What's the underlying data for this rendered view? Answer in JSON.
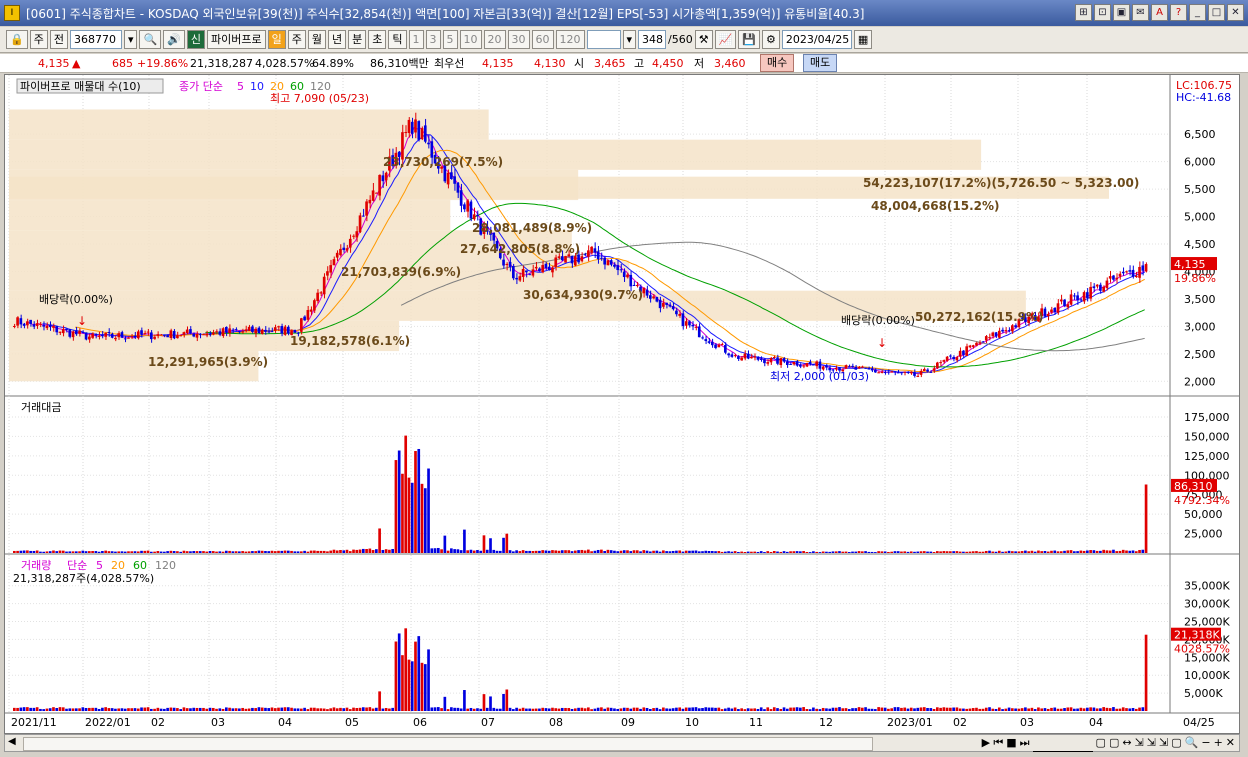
{
  "window": {
    "title": "[0601] 주식종합차트 - KOSDAQ 외국인보유[39(천)] 주식수[32,854(천)] 액면[100] 자본금[33(억)] 결산[12월] EPS[-53] 시가총액[1,359(억)] 유통비율[40.3]",
    "icon_label": "I",
    "buttons": [
      "⊞",
      "⊡",
      "▣",
      "✉",
      "A",
      "?",
      "_",
      "□",
      "✕"
    ]
  },
  "toolbar": {
    "market_select": "주",
    "prev_label": "전",
    "code": "368770",
    "name_button": "파이버프로",
    "name_prefix": "신",
    "period_tabs": [
      "일",
      "주",
      "월",
      "년",
      "분",
      "초",
      "틱"
    ],
    "minute_buttons": [
      "1",
      "3",
      "5",
      "10",
      "20",
      "30",
      "60",
      "120"
    ],
    "count": "348",
    "count_total": "/560",
    "date": "2023/04/25"
  },
  "quote": {
    "price": "4,135",
    "change_arrow": "▲",
    "change": "685",
    "change_pct": "+19.86%",
    "volume": "21,318,287",
    "volume_pct": "4,028.57%",
    "turnover": "64.89%",
    "amount": "86,310백만",
    "best_bid_label": "최우선",
    "ask": "4,135",
    "bid": "4,130",
    "open_label": "시",
    "open": "3,465",
    "high_label": "고",
    "high": "4,450",
    "low_label": "저",
    "low": "3,460",
    "buy": "매수",
    "sell": "매도"
  },
  "chart_data": {
    "type": "candlestick",
    "panel_title": "파이버프로 매물대 수(10)",
    "ma_title": "종가 단순",
    "ma_periods": [
      "5",
      "10",
      "20",
      "60",
      "120"
    ],
    "ma_colors": [
      "#d400d4",
      "#1a1aff",
      "#ff9900",
      "#00a000",
      "#808080"
    ],
    "lc_label": "LC:106.75",
    "hc_label": "HC:-41.68",
    "price_axis": [
      "6,500",
      "6,000",
      "5,500",
      "5,000",
      "4,500",
      "4,000",
      "3,500",
      "3,000",
      "2,500",
      "2,000"
    ],
    "price_ylim": [
      1750,
      7250
    ],
    "current_price_label": "4,135",
    "current_pct_label": "19.86%",
    "high_annotation": "최고 7,090 (05/23)",
    "low_annotation": "최저 2,000 (01/03)",
    "ex_dividend_labels": [
      "배당락(0.00%)",
      "배당락(0.00%)"
    ],
    "volume_profile": [
      {
        "label": "12,291,965(3.9%)",
        "low": 2000,
        "high": 2550
      },
      {
        "label": "19,182,578(6.1%)",
        "low": 2550,
        "high": 3100
      },
      {
        "label": "50,272,162(15.9%)",
        "low": 3100,
        "high": 3650
      },
      {
        "label": "30,634,930(9.7%)",
        "low": 3650,
        "high": 4200
      },
      {
        "label": "27,642,805(8.8%)",
        "low": 4200,
        "high": 4750
      },
      {
        "label": "21,703,839(6.9%)",
        "low": 4750,
        "high": 5300
      },
      {
        "label": "28,081,489(8.9%)",
        "low": 5300,
        "high": 5850
      },
      {
        "label": "48,004,668(15.2%)",
        "low": 5850,
        "high": 6400
      },
      {
        "label": "54,223,107(17.2%)(5,726.50 ~ 5,323.00)",
        "low": 5323,
        "high": 5726.5
      },
      {
        "label": "23,730,269(7.5%)",
        "low": 6400,
        "high": 6950
      }
    ],
    "amount_panel": {
      "title": "거래대금",
      "axis": [
        "175,000",
        "150,000",
        "125,000",
        "100,000",
        "75,000",
        "50,000",
        "25,000"
      ],
      "current_label": "86,310",
      "current_pct": "4792.34%"
    },
    "volume_panel": {
      "title": "거래량",
      "ma_title": "단순",
      "ma_periods": [
        "5",
        "20",
        "60",
        "120"
      ],
      "summary": "21,318,287주(4,028.57%)",
      "axis": [
        "35,000K",
        "30,000K",
        "25,000K",
        "20,000K",
        "15,000K",
        "10,000K",
        "5,000K"
      ],
      "current_label": "21,318K",
      "current_pct": "4028.57%"
    },
    "x_axis": [
      "2021/11",
      "2022/01",
      "02",
      "03",
      "04",
      "05",
      "06",
      "07",
      "08",
      "09",
      "10",
      "11",
      "12",
      "2023/01",
      "02",
      "03",
      "04",
      "04/25"
    ],
    "key_points": [
      {
        "date": "2021/11",
        "close": 3100
      },
      {
        "date": "2022/01",
        "close": 2800
      },
      {
        "date": "04",
        "close": 2950
      },
      {
        "date": "05/23",
        "close": 6700,
        "high": 7090
      },
      {
        "date": "07",
        "close": 3900
      },
      {
        "date": "08",
        "close": 4350
      },
      {
        "date": "09",
        "close": 3000
      },
      {
        "date": "10",
        "close": 2450
      },
      {
        "date": "01/03",
        "close": 2100,
        "low": 2000
      },
      {
        "date": "03",
        "close": 2950
      },
      {
        "date": "04/25",
        "close": 4135,
        "high": 4450
      }
    ]
  },
  "scroll_controls": [
    "▶",
    "⏮",
    "■",
    "⏭",
    "🔍",
    "−",
    "+",
    "✕"
  ]
}
